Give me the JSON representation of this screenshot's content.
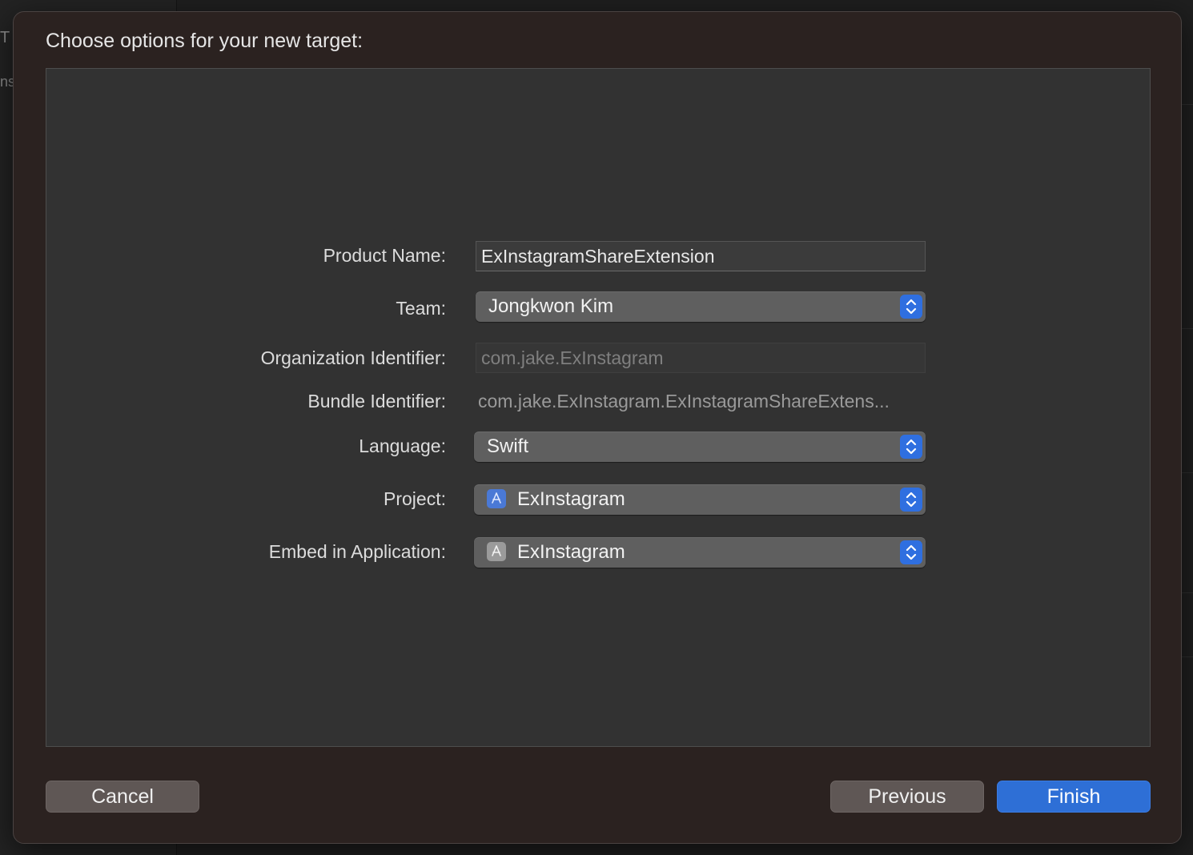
{
  "sheet": {
    "title": "Choose options for your new target:"
  },
  "form": {
    "product_name": {
      "label": "Product Name:",
      "value": "ExInstagramShareExtension"
    },
    "team": {
      "label": "Team:",
      "value": "Jongkwon Kim"
    },
    "organization_identifier": {
      "label": "Organization Identifier:",
      "value": "com.jake.ExInstagram"
    },
    "bundle_identifier": {
      "label": "Bundle Identifier:",
      "value": "com.jake.ExInstagram.ExInstagramShareExtens..."
    },
    "language": {
      "label": "Language:",
      "value": "Swift"
    },
    "project": {
      "label": "Project:",
      "value": "ExInstagram",
      "icon": "xcode-project-icon"
    },
    "embed_in_application": {
      "label": "Embed in Application:",
      "value": "ExInstagram",
      "icon": "app-icon"
    }
  },
  "buttons": {
    "cancel": "Cancel",
    "previous": "Previous",
    "finish": "Finish"
  },
  "background": {
    "edge_letters": [
      "T",
      "ns"
    ]
  },
  "colors": {
    "accent": "#2e6fd6",
    "sheet_bg": "#2b2220",
    "panel_bg": "#323232"
  }
}
